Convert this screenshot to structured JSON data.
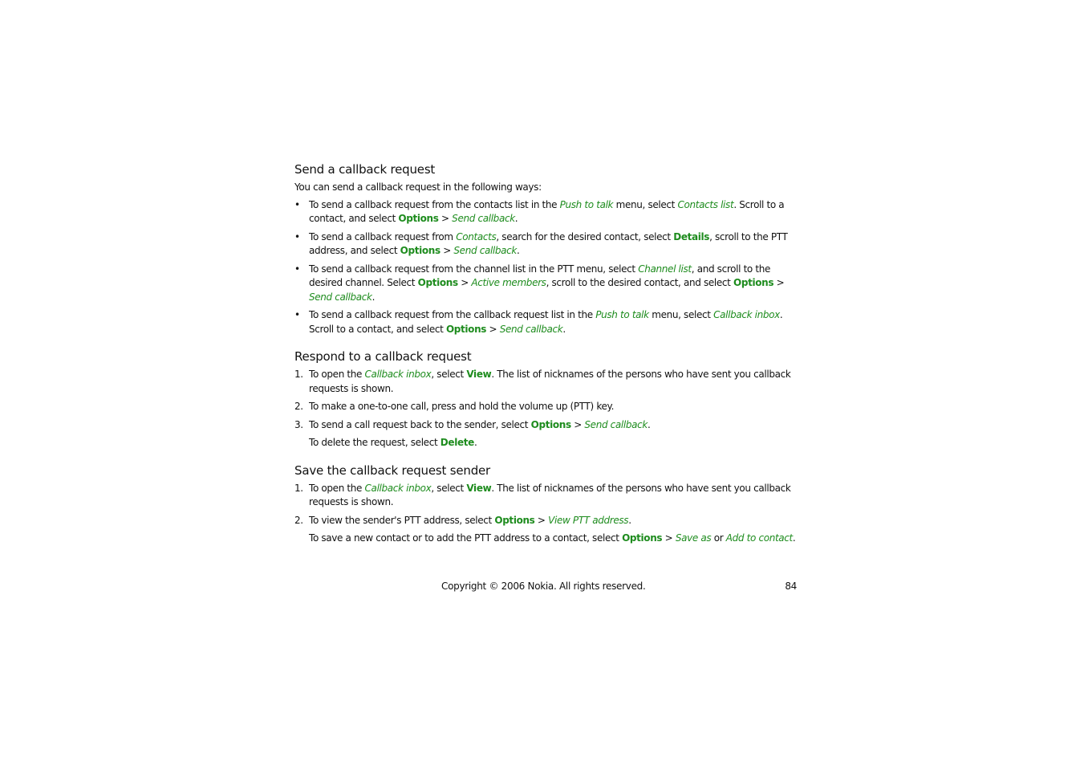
{
  "sections": [
    {
      "heading": "Send a callback request",
      "intro": "You can send a callback request in the following ways:",
      "bullets": [
        [
          {
            "t": "To send a callback request from the contacts list in the "
          },
          {
            "t": "Push to talk",
            "s": "i"
          },
          {
            "t": " menu, select "
          },
          {
            "t": "Contacts list",
            "s": "i"
          },
          {
            "t": ". Scroll to a contact, and select "
          },
          {
            "t": "Options",
            "s": "b"
          },
          {
            "t": " > "
          },
          {
            "t": "Send callback",
            "s": "i"
          },
          {
            "t": "."
          }
        ],
        [
          {
            "t": "To send a callback request from "
          },
          {
            "t": "Contacts",
            "s": "i"
          },
          {
            "t": ", search for the desired contact, select "
          },
          {
            "t": "Details",
            "s": "b"
          },
          {
            "t": ", scroll to the PTT address, and select "
          },
          {
            "t": "Options",
            "s": "b"
          },
          {
            "t": " > "
          },
          {
            "t": "Send callback",
            "s": "i"
          },
          {
            "t": "."
          }
        ],
        [
          {
            "t": "To send a callback request from the channel list in the PTT menu, select "
          },
          {
            "t": "Channel list",
            "s": "i"
          },
          {
            "t": ", and scroll to the desired channel. Select "
          },
          {
            "t": "Options",
            "s": "b"
          },
          {
            "t": " > "
          },
          {
            "t": "Active members",
            "s": "i"
          },
          {
            "t": ", scroll to the desired contact, and select "
          },
          {
            "t": "Options",
            "s": "b"
          },
          {
            "t": " > "
          },
          {
            "t": "Send callback",
            "s": "i"
          },
          {
            "t": "."
          }
        ],
        [
          {
            "t": "To send a callback request from the callback request list in the "
          },
          {
            "t": "Push to talk",
            "s": "i"
          },
          {
            "t": " menu, select "
          },
          {
            "t": "Callback inbox",
            "s": "i"
          },
          {
            "t": ". Scroll to a contact, and select "
          },
          {
            "t": "Options",
            "s": "b"
          },
          {
            "t": " > "
          },
          {
            "t": "Send callback",
            "s": "i"
          },
          {
            "t": "."
          }
        ]
      ]
    },
    {
      "heading": "Respond to a callback request",
      "steps": [
        {
          "num": "1.",
          "segs": [
            {
              "t": "To open the "
            },
            {
              "t": "Callback inbox",
              "s": "i"
            },
            {
              "t": ", select "
            },
            {
              "t": "View",
              "s": "b"
            },
            {
              "t": ". The list of nicknames of the persons who have sent you callback requests is shown."
            }
          ]
        },
        {
          "num": "2.",
          "segs": [
            {
              "t": "To make a one-to-one call, press and hold the volume up (PTT) key."
            }
          ]
        },
        {
          "num": "3.",
          "segs": [
            {
              "t": "To send a call request back to the sender, select "
            },
            {
              "t": "Options",
              "s": "b"
            },
            {
              "t": " > "
            },
            {
              "t": "Send callback",
              "s": "i"
            },
            {
              "t": "."
            }
          ]
        }
      ],
      "note": [
        {
          "t": "To delete the request, select "
        },
        {
          "t": "Delete",
          "s": "b"
        },
        {
          "t": "."
        }
      ]
    },
    {
      "heading": "Save the callback request sender",
      "steps": [
        {
          "num": "1.",
          "segs": [
            {
              "t": "To open the "
            },
            {
              "t": "Callback inbox",
              "s": "i"
            },
            {
              "t": ", select "
            },
            {
              "t": "View",
              "s": "b"
            },
            {
              "t": ". The list of nicknames of the persons who have sent you callback requests is shown."
            }
          ]
        },
        {
          "num": "2.",
          "segs": [
            {
              "t": "To view the sender's PTT address, select "
            },
            {
              "t": "Options",
              "s": "b"
            },
            {
              "t": " > "
            },
            {
              "t": "View PTT address",
              "s": "i"
            },
            {
              "t": "."
            }
          ]
        }
      ],
      "note": [
        {
          "t": "To save a new contact or to add the PTT address to a contact, select "
        },
        {
          "t": "Options",
          "s": "b"
        },
        {
          "t": " > "
        },
        {
          "t": "Save as",
          "s": "i"
        },
        {
          "t": " or "
        },
        {
          "t": "Add to contact",
          "s": "i"
        },
        {
          "t": "."
        }
      ]
    }
  ],
  "footer": {
    "copyright": "Copyright © 2006 Nokia. All rights reserved.",
    "page_number": "84"
  },
  "colors": {
    "accent_green": "#1e8c1e"
  },
  "bullet_glyph": "•"
}
